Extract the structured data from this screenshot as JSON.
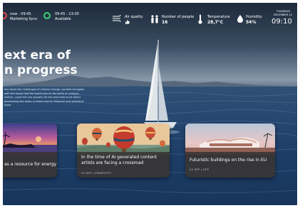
{
  "status_bar": {
    "event1": {
      "time": "now - 09:45",
      "title": "Marketing Sync",
      "ring_color": "#e8484b"
    },
    "event2": {
      "time": "09:45 - 13:00",
      "title": "Available",
      "ring_color": "#3ad178"
    },
    "air_quality": {
      "label": "Air quality",
      "icon": "air-quality-icon"
    },
    "people": {
      "label": "Number of people",
      "value": "16",
      "icon": "people-icon"
    },
    "temperature": {
      "label": "Temperature",
      "value": "28,7°C",
      "icon": "thermometer-icon"
    },
    "humidity": {
      "label": "Humidity",
      "value": "54%",
      "icon": "droplet-icon"
    },
    "clock": {
      "weekday": "THURSDAY",
      "date": "DECEMBER 12",
      "time": "09:10"
    }
  },
  "hero": {
    "title_line1": "ext era of",
    "title_line2": "n progress",
    "body": "has faced the challenges of climate change, societal struggles with the sense that the world was on the brink of collapse. history, could this era actually be the best time to be alive? dominating the news, a closer look at historical and statistical hope."
  },
  "cards": [
    {
      "title": "as a resource for energy",
      "meta": ""
    },
    {
      "title": "In the time of AI generated content artists are facing a crossroad",
      "meta": "22 SEP | CREATIVITY"
    },
    {
      "title": "Futuristic buildings on the rise in EU",
      "meta": "22 SEP | LIFE"
    }
  ]
}
